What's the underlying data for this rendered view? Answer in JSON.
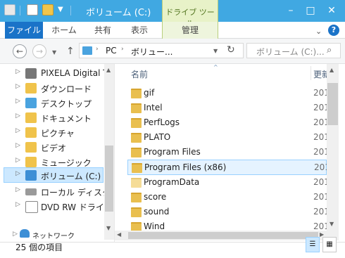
{
  "window": {
    "title": "ボリューム (C:)",
    "contextual_tab_group": "ドライブ ツール",
    "controls": {
      "minimize": "–",
      "maximize": "□",
      "close": "✕"
    }
  },
  "ribbon": {
    "tabs": [
      "ファイル",
      "ホーム",
      "共有",
      "表示",
      "管理"
    ],
    "help": "?"
  },
  "address": {
    "back": "←",
    "forward": "→",
    "up": "↑",
    "crumbs": [
      "PC",
      "ボリュー..."
    ],
    "refresh": "↻",
    "search_placeholder": "ボリューム (C:)..."
  },
  "nav": {
    "items": [
      {
        "label": "PIXELA Digital T",
        "icon": "camera-icon"
      },
      {
        "label": "ダウンロード",
        "icon": "download-folder-icon"
      },
      {
        "label": "デスクトップ",
        "icon": "desktop-folder-icon"
      },
      {
        "label": "ドキュメント",
        "icon": "documents-folder-icon"
      },
      {
        "label": "ピクチャ",
        "icon": "pictures-folder-icon"
      },
      {
        "label": "ビデオ",
        "icon": "videos-folder-icon"
      },
      {
        "label": "ミュージック",
        "icon": "music-folder-icon"
      },
      {
        "label": "ボリューム (C:)",
        "icon": "windows-drive-icon",
        "selected": true
      },
      {
        "label": "ローカル ディスク (D",
        "icon": "drive-icon"
      },
      {
        "label": "DVD RW ドライブ",
        "icon": "dvd-drive-icon"
      }
    ],
    "network": "ネットワーク"
  },
  "files": {
    "headers": {
      "name": "名前",
      "date": "更新"
    },
    "rows": [
      {
        "name": "gif",
        "date": "201"
      },
      {
        "name": "Intel",
        "date": "201"
      },
      {
        "name": "PerfLogs",
        "date": "201"
      },
      {
        "name": "PLATO",
        "date": "201"
      },
      {
        "name": "Program Files",
        "date": "201"
      },
      {
        "name": "Program Files (x86)",
        "date": "201",
        "selected": true
      },
      {
        "name": "ProgramData",
        "date": "201"
      },
      {
        "name": "score",
        "date": "201"
      },
      {
        "name": "sound",
        "date": "201"
      },
      {
        "name": "Wind",
        "date": "201"
      }
    ]
  },
  "status": {
    "count": "25 個の項目"
  },
  "colors": {
    "titlebar": "#40a8e2",
    "file_tab": "#1a73c8",
    "selection": "#cce8ff",
    "folder": "#e9bf4f"
  }
}
